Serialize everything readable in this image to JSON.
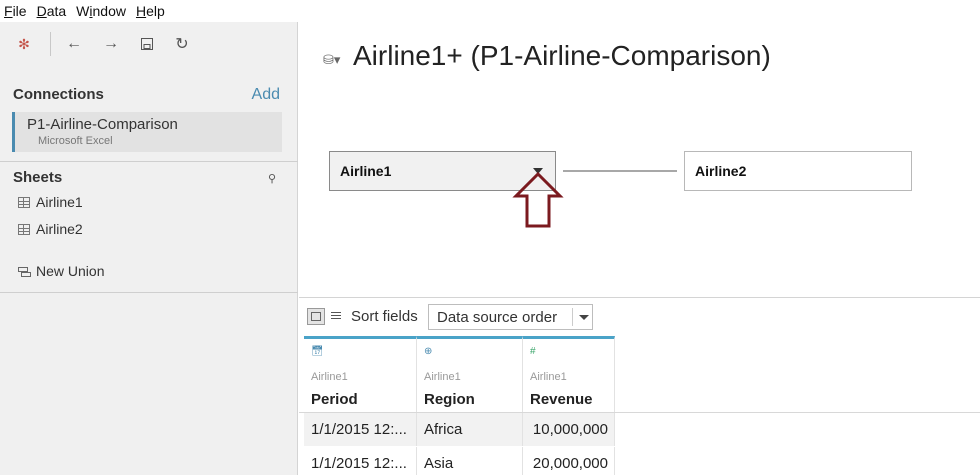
{
  "menu": [
    {
      "pre": "",
      "u": "F",
      "post": "ile"
    },
    {
      "pre": "",
      "u": "D",
      "post": "ata"
    },
    {
      "pre": "W",
      "u": "i",
      "post": "ndow"
    },
    {
      "pre": "",
      "u": "H",
      "post": "elp"
    }
  ],
  "toolbar": {
    "icons": [
      "tableau-logo-icon",
      "back-arrow-icon",
      "forward-arrow-icon",
      "save-icon",
      "refresh-icon"
    ]
  },
  "connections": {
    "title": "Connections",
    "add_label": "Add",
    "items": [
      {
        "name": "P1-Airline-Comparison",
        "type": "Microsoft Excel"
      }
    ]
  },
  "sheets": {
    "title": "Sheets",
    "items": [
      "Airline1",
      "Airline2"
    ],
    "new_union": "New Union"
  },
  "canvas": {
    "title": "Airline1+ (P1-Airline-Comparison)",
    "tables": [
      "Airline1",
      "Airline2"
    ]
  },
  "grid_toolbar": {
    "sort_label": "Sort fields",
    "sort_value": "Data source order"
  },
  "columns": [
    {
      "source": "Airline1",
      "field": "Period",
      "type_icon": "date-time-icon"
    },
    {
      "source": "Airline1",
      "field": "Region",
      "type_icon": "globe-icon"
    },
    {
      "source": "Airline1",
      "field": "Revenue",
      "type_icon": "number-icon"
    }
  ],
  "rows": [
    [
      "1/1/2015 12:...",
      "Africa",
      "10,000,000"
    ],
    [
      "1/1/2015 12:...",
      "Asia",
      "20,000,000"
    ]
  ],
  "colors": {
    "accent": "#4a8bb0",
    "annotation_arrow": "#7b1a1f"
  }
}
